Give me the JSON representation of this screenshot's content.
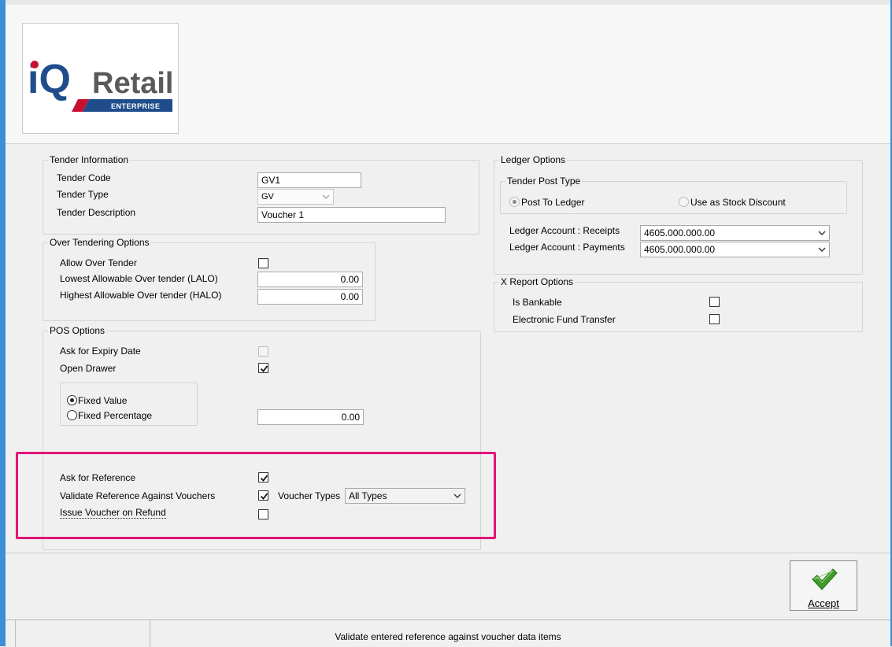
{
  "logo": {
    "prefix": "iQ",
    "name": "Retail",
    "tag": "ENTERPRISE"
  },
  "tender_info": {
    "title": "Tender Information",
    "code_label": "Tender Code",
    "code_value": "GV1",
    "type_label": "Tender Type",
    "type_value": "GV",
    "desc_label": "Tender  Description",
    "desc_value": "Voucher 1"
  },
  "over_tendering": {
    "title": "Over Tendering Options",
    "allow_label": "Allow Over Tender",
    "allow_checked": false,
    "lalo_label": "Lowest Allowable Over tender (LALO)",
    "lalo_value": "0.00",
    "halo_label": "Highest Allowable Over tender (HALO)",
    "halo_value": "0.00"
  },
  "pos_options": {
    "title": "POS Options",
    "expiry_label": "Ask for Expiry Date",
    "expiry_checked": false,
    "drawer_label": "Open Drawer",
    "drawer_checked": true,
    "fixed_value_label": "Fixed Value",
    "fixed_percentage_label": "Fixed Percentage",
    "fixed_selected": "Fixed Value",
    "amount_value": "0.00",
    "ask_reference_label": "Ask for Reference",
    "ask_reference_checked": true,
    "validate_reference_label": "Validate Reference Against Vouchers",
    "validate_reference_checked": true,
    "voucher_types_label": "Voucher Types",
    "voucher_types_value": "All Types",
    "issue_voucher_label": "Issue Voucher on Refund",
    "issue_voucher_checked": false
  },
  "ledger_options": {
    "title": "Ledger Options",
    "post_type_title": "Tender Post Type",
    "post_to_ledger_label": "Post To Ledger",
    "stock_discount_label": "Use as Stock Discount",
    "post_selected": "Post To Ledger",
    "receipts_label": "Ledger Account : Receipts",
    "receipts_value": "4605.000.000.00",
    "payments_label": "Ledger Account : Payments",
    "payments_value": "4605.000.000.00"
  },
  "x_report": {
    "title": "X Report Options",
    "bankable_label": "Is Bankable",
    "bankable_checked": false,
    "eft_label": "Electronic Fund Transfer",
    "eft_checked": false
  },
  "actions": {
    "accept_label": "Accept"
  },
  "status": {
    "message": "Validate entered reference against voucher data items"
  },
  "colors": {
    "highlight": "#e0157a",
    "accept_check": "#3f9a2a",
    "logo_blue": "#1f4d8c",
    "logo_red": "#c8102e"
  }
}
